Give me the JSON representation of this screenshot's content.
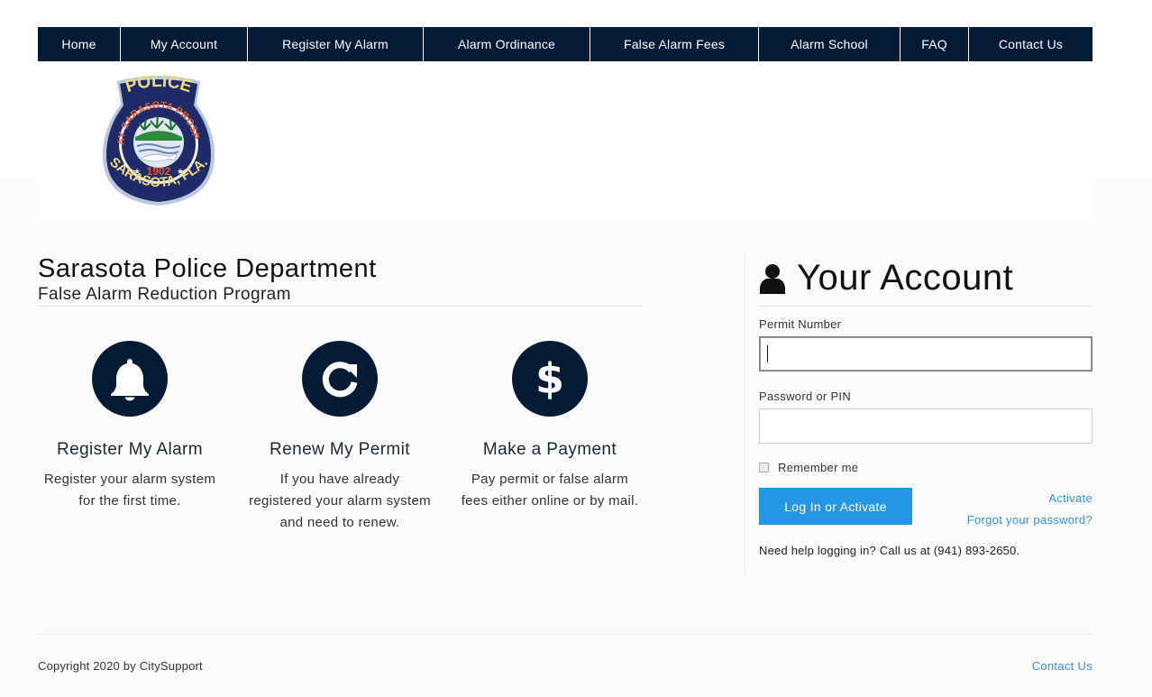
{
  "nav": {
    "items": [
      {
        "label": "Home"
      },
      {
        "label": "My Account"
      },
      {
        "label": "Register My Alarm"
      },
      {
        "label": "Alarm Ordinance"
      },
      {
        "label": "False Alarm Fees"
      },
      {
        "label": "Alarm School"
      },
      {
        "label": "FAQ"
      },
      {
        "label": "Contact Us"
      }
    ]
  },
  "logo": {
    "top_text": "POLICE",
    "ring_text": "MAY SARASOTA PROSPER",
    "year": "1902",
    "bottom_text": "SARASOTA, FLA."
  },
  "main": {
    "title": "Sarasota Police Department",
    "subtitle": "False Alarm Reduction Program",
    "features": [
      {
        "icon": "bell-icon",
        "title": "Register My Alarm",
        "description": "Register your alarm system for the first time."
      },
      {
        "icon": "refresh-icon",
        "title": "Renew My Permit",
        "description": "If you have already registered your alarm system and need to renew."
      },
      {
        "icon": "dollar-icon",
        "title": "Make a Payment",
        "description": "Pay permit or false alarm fees either online or by mail."
      }
    ]
  },
  "account": {
    "title": "Your Account",
    "permit_label": "Permit Number",
    "permit_value": "",
    "password_label": "Password or PIN",
    "password_value": "",
    "remember_label": "Remember me",
    "remember_checked": false,
    "login_button": "Log In or Activate",
    "activate_link": "Activate",
    "forgot_link": "Forgot your password?",
    "help_text": "Need help logging in? Call us at (941) 893-2650."
  },
  "footer": {
    "copyright": "Copyright 2020 by CitySupport",
    "contact_link": "Contact Us"
  },
  "colors": {
    "nav_bg": "#041a35",
    "accent_button": "#2396e4",
    "link": "#3a8fd4",
    "icon_circle": "#041a35"
  }
}
